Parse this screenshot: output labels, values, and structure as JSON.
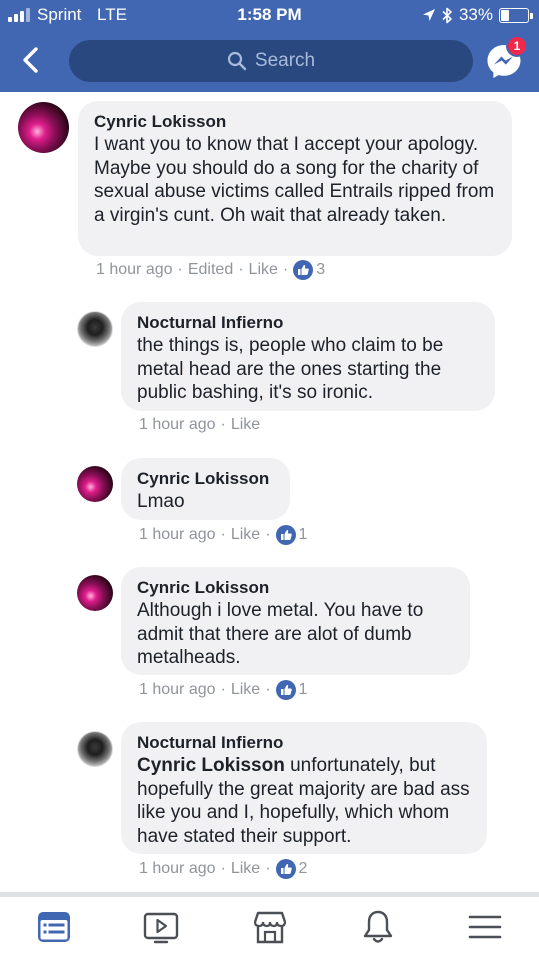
{
  "status_bar": {
    "carrier": "Sprint",
    "network": "LTE",
    "time": "1:58 PM",
    "battery": "33%",
    "battery_level": 0.33
  },
  "header": {
    "search_placeholder": "Search",
    "messenger_badge": "1"
  },
  "comments": [
    {
      "author": "Cynric Lokisson",
      "text": "I want you to know that I accept your apology. Maybe you should do a song for the charity of sexual abuse victims called Entrails ripped from a virgin's cunt. Oh wait that already taken.",
      "time": "1 hour ago",
      "edited": "Edited",
      "like": "Like",
      "likes": "3"
    },
    {
      "author": "Nocturnal Infierno",
      "text": "the things is, people who claim to be metal head are the ones starting the public bashing, it's so ironic.",
      "time": "1 hour ago",
      "like": "Like"
    },
    {
      "author": "Cynric Lokisson",
      "text": "Lmao",
      "time": "1 hour ago",
      "like": "Like",
      "likes": "1"
    },
    {
      "author": "Cynric Lokisson",
      "text": "Although i love metal. You have to admit that there are alot of dumb metalheads.",
      "time": "1 hour ago",
      "like": "Like",
      "likes": "1"
    },
    {
      "author": "Nocturnal Infierno",
      "mention": "Cynric Lokisson",
      "text": " unfortunately, but hopefully the great majority are bad ass like you and I, hopefully, which whom have stated their support.",
      "time": "1 hour ago",
      "like": "Like",
      "likes": "2"
    }
  ],
  "separator": "·",
  "icons": {
    "back": "chevron-left-icon",
    "search": "search-icon",
    "messenger": "messenger-icon",
    "like": "thumbs-up-icon",
    "nav": [
      "news-feed-icon",
      "watch-icon",
      "marketplace-icon",
      "notifications-icon",
      "menu-icon"
    ]
  },
  "colors": {
    "brand": "#4267b2",
    "search_bg": "#28487f",
    "badge": "#f02849",
    "bubble": "#f1f1f3",
    "meta_text": "#90949c",
    "nav_active": "#4267b2",
    "nav_inactive": "#4b4f56"
  }
}
